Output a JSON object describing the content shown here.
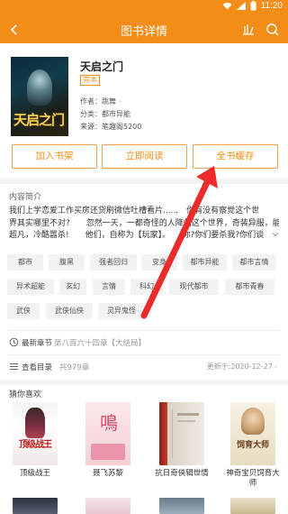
{
  "status_bar": {
    "time": "11:20"
  },
  "app_bar": {
    "title": "图书详情"
  },
  "book": {
    "title": "天启之门",
    "status": "完本",
    "cover_text": "天启之门",
    "author_label": "作者：",
    "author": "跳舞",
    "category_label": "分类：",
    "category": "都市异能",
    "source_label": "来源：",
    "source": "笔趣阁5200"
  },
  "actions": {
    "add_shelf": "加入书架",
    "read_now": "立即阅读",
    "cache_all": "全书缓存"
  },
  "intro": {
    "heading": "内容简介",
    "line1": "我们上学恋爱工作买房还贷刷微信吐槽看片......　你有没有察觉这个世",
    "line2": "界其实哪里不对?　　忽然一天，一都奇怪的人降临这个世界，奇装异服，能力",
    "line3": "超凡，冷酷嚣杀!　　他们，自称为【玩家】。　　你?你们要杀我?你们谈"
  },
  "tags": [
    "都市",
    "腹黑",
    "强者回归",
    "变身",
    "都市异能",
    "都市言情",
    "异术超能",
    "玄幻",
    "言情",
    "科幻",
    "现代都市",
    "都市青春",
    "武侠",
    "武侠仙侠",
    "灵异鬼怪"
  ],
  "latest": {
    "label": "最新章节",
    "value": "第八百六十四章【大结局】"
  },
  "toc": {
    "label": "查看目录",
    "value": "共979章",
    "updated": "更新于:2020-12-27"
  },
  "recommend": {
    "heading": "猜你喜欢",
    "books": [
      {
        "name": "顶级战王",
        "cover_text": "顶级战王"
      },
      {
        "name": "聂飞苏黎",
        "cover_text": ""
      },
      {
        "name": "抗日奇侠辑世情",
        "cover_text": ""
      },
      {
        "name": "神奇宝贝饲育大师",
        "cover_text": "饲育大师"
      },
      {
        "name": "",
        "cover_text": ""
      }
    ]
  },
  "colors": {
    "accent": "#f38d17",
    "arrow": "#ec2b2b"
  }
}
